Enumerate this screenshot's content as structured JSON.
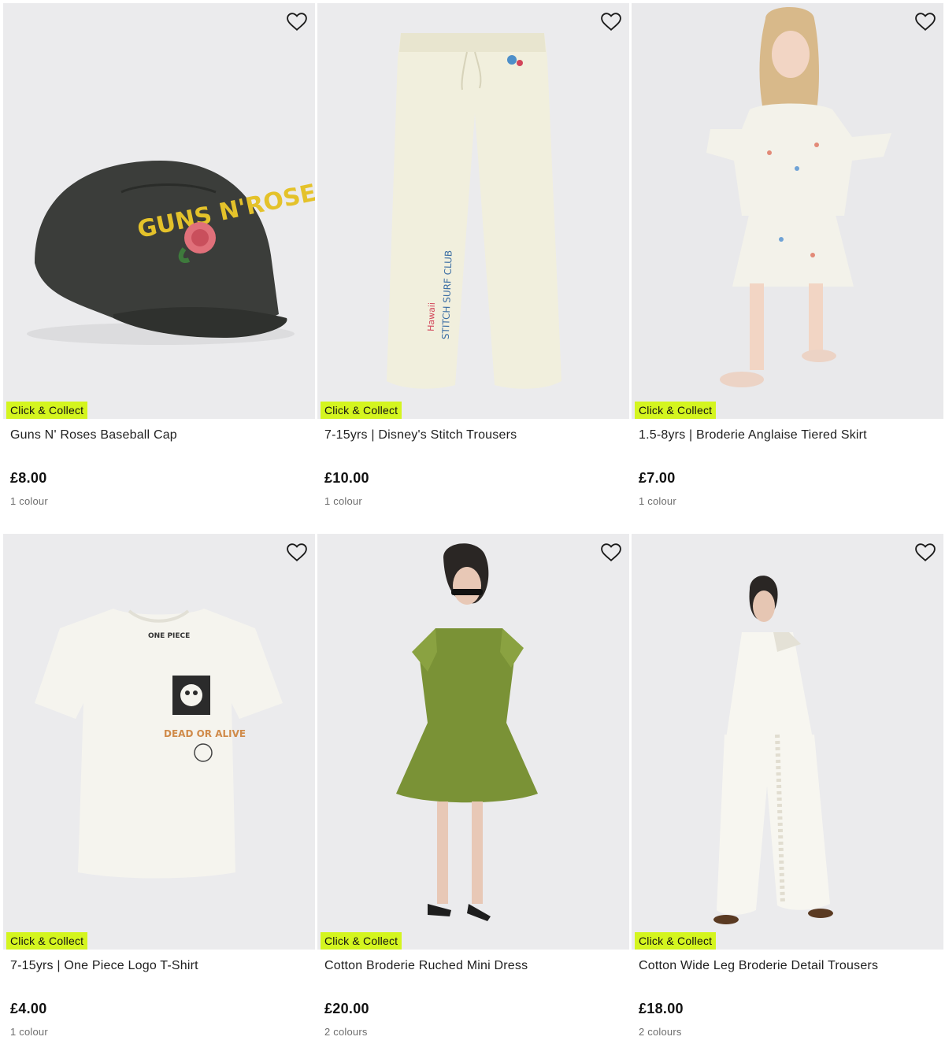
{
  "products": [
    {
      "name": "Guns N' Roses Baseball Cap",
      "price": "£8.00",
      "colours": "1 colour",
      "badge": "Click & Collect",
      "image": "black-baseball-cap-with-rose-embroidery"
    },
    {
      "name": "7-15yrs | Disney's Stitch Trousers",
      "price": "£10.00",
      "colours": "1 colour",
      "badge": "Click & Collect",
      "image": "cream-wide-leg-trousers"
    },
    {
      "name": "1.5-8yrs | Broderie Anglaise Tiered Skirt",
      "price": "£7.00",
      "colours": "1 colour",
      "badge": "Click & Collect",
      "image": "child-in-white-broderie-set"
    },
    {
      "name": "7-15yrs | One Piece Logo T-Shirt",
      "price": "£4.00",
      "colours": "1 colour",
      "badge": "Click & Collect",
      "image": "white-graphic-tshirt"
    },
    {
      "name": "Cotton Broderie Ruched Mini Dress",
      "price": "£20.00",
      "colours": "2 colours",
      "badge": "Click & Collect",
      "image": "woman-in-green-mini-dress"
    },
    {
      "name": "Cotton Wide Leg Broderie Detail Trousers",
      "price": "£18.00",
      "colours": "2 colours",
      "badge": "Click & Collect",
      "image": "woman-in-white-wide-trousers"
    }
  ],
  "icons": {
    "wishlist": "heart-outline-icon"
  },
  "colors": {
    "badge_bg": "#d4f51f",
    "image_bg": "#ebebed",
    "secondary_text": "#6d6d6d"
  }
}
